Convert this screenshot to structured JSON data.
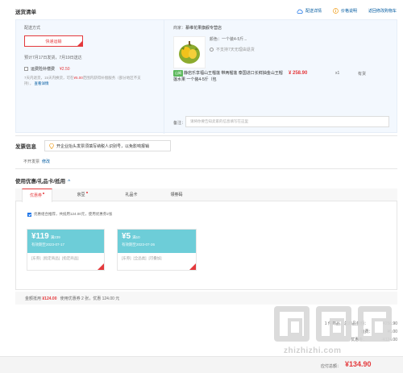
{
  "header": {
    "title": "送货清单",
    "links": [
      "配送详情",
      "价格说明",
      "返回修改购物车"
    ]
  },
  "shipping": {
    "label": "配送方式",
    "method": "快递运输",
    "date_note": "预计7月17日发货，7月19日送达",
    "insurance_label": "运费险补偿费",
    "insurance_price": "¥2.50",
    "note_part1": "7天内退货，15天内换货，可在",
    "note_red": "¥5.00",
    "note_part2": "范围内获得补偿服务（部分地区不支持），",
    "note_link": "查看详情"
  },
  "seller": {
    "label": "商家：",
    "name": "慕维花果旗舰专营店"
  },
  "product": {
    "attr1": "颜色：一个装4-5斤...",
    "attr2": "不支持7天无理由退货",
    "tag": "山姆",
    "title": "静岩乐享福山王榴莲 带两榴莲 泰国进口长鲜抽金山王榴莲水果 一个装4-5斤（包",
    "price": "¥ 258.90",
    "qty": "x1",
    "stock": "有货"
  },
  "remark": {
    "label": "备注：",
    "placeholder": "请将你要告知卖家的信息填写在这里"
  },
  "invoice": {
    "title": "发票信息",
    "notice": "开企业抬头发票须填写纳税人识别号，以免影响报销",
    "status": "不开发票",
    "edit": "修改"
  },
  "coupons": {
    "title": "使用优惠/礼品卡/抵用",
    "tabs": [
      "优惠券",
      "京豆",
      "礼品卡",
      "领劵码"
    ],
    "option_text": "优惠组合推荐，共抵用124.00元，使用优惠券2张",
    "items": [
      {
        "amount": "¥119",
        "condition": "满239",
        "expiry": "有效期至2023-07-17",
        "tags": [
          "[东券]",
          "[指定商品]",
          "[指定商品]"
        ]
      },
      {
        "amount": "¥5",
        "condition": "满10",
        "expiry": "有效期至2023-07-26",
        "tags": [
          "[东券]",
          "[全品类]",
          "[可叠加]"
        ]
      }
    ],
    "summary_label": "金额抵用",
    "summary_amount": "¥124.00",
    "summary_detail": "使用优惠券 2 张，优惠 124.00 元"
  },
  "totals": {
    "rows": [
      {
        "label": "1 件商品，总商品金额：",
        "value": "¥258.90"
      },
      {
        "label": "运费：",
        "value": "¥0.00"
      },
      {
        "label": "优惠券：",
        "value": "-¥124.00"
      }
    ]
  },
  "pay": {
    "label": "应付总额：",
    "amount": "¥134.90"
  },
  "watermark": {
    "url": "zhizhizhi.com"
  },
  "colors": {
    "accent": "#e4393c",
    "link": "#005aa0",
    "coupon": "#6dcdd8"
  }
}
